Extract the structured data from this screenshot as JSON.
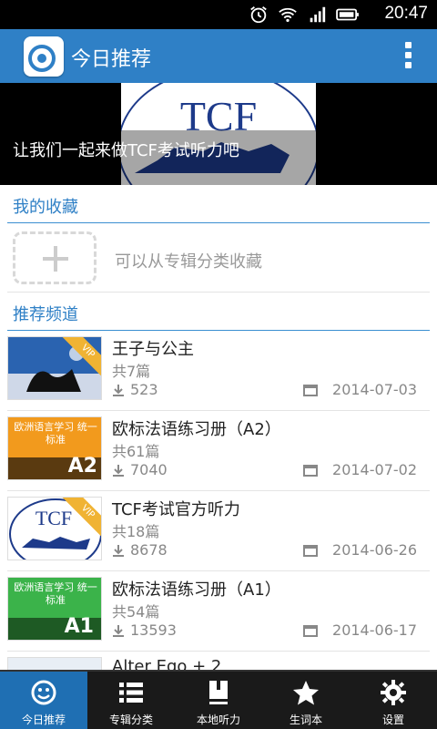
{
  "status_bar": {
    "time": "20:47"
  },
  "app_bar": {
    "title": "今日推荐"
  },
  "banner": {
    "caption": "让我们一起来做TCF考试听力吧",
    "image_text": "TCF"
  },
  "favorites": {
    "title": "我的收藏",
    "hint": "可以从专辑分类收藏"
  },
  "recommended": {
    "title": "推荐频道",
    "items": [
      {
        "title": "王子与公主",
        "count": "共7篇",
        "downloads": "523",
        "date": "2014-07-03",
        "vip": "VIP"
      },
      {
        "title": "欧标法语练习册（A2）",
        "count": "共61篇",
        "downloads": "7040",
        "date": "2014-07-02",
        "cover_text": "欧洲语言学习 统一标准",
        "cover_level": "A2"
      },
      {
        "title": "TCF考试官方听力",
        "count": "共18篇",
        "downloads": "8678",
        "date": "2014-06-26",
        "vip": "VIP"
      },
      {
        "title": "欧标法语练习册（A1）",
        "count": "共54篇",
        "downloads": "13593",
        "date": "2014-06-17",
        "cover_text": "欧洲语言学习 统一标准",
        "cover_level": "A1"
      },
      {
        "title": "Alter Ego + 2",
        "count": "",
        "downloads": "",
        "date": ""
      }
    ]
  },
  "tabs": [
    {
      "label": "今日推荐",
      "icon": "smiley-icon"
    },
    {
      "label": "专辑分类",
      "icon": "list-icon"
    },
    {
      "label": "本地听力",
      "icon": "book-icon"
    },
    {
      "label": "生词本",
      "icon": "star-icon"
    },
    {
      "label": "设置",
      "icon": "gear-icon"
    }
  ],
  "colors": {
    "primary": "#2f80c6",
    "active_tab": "#1f6fb3"
  }
}
